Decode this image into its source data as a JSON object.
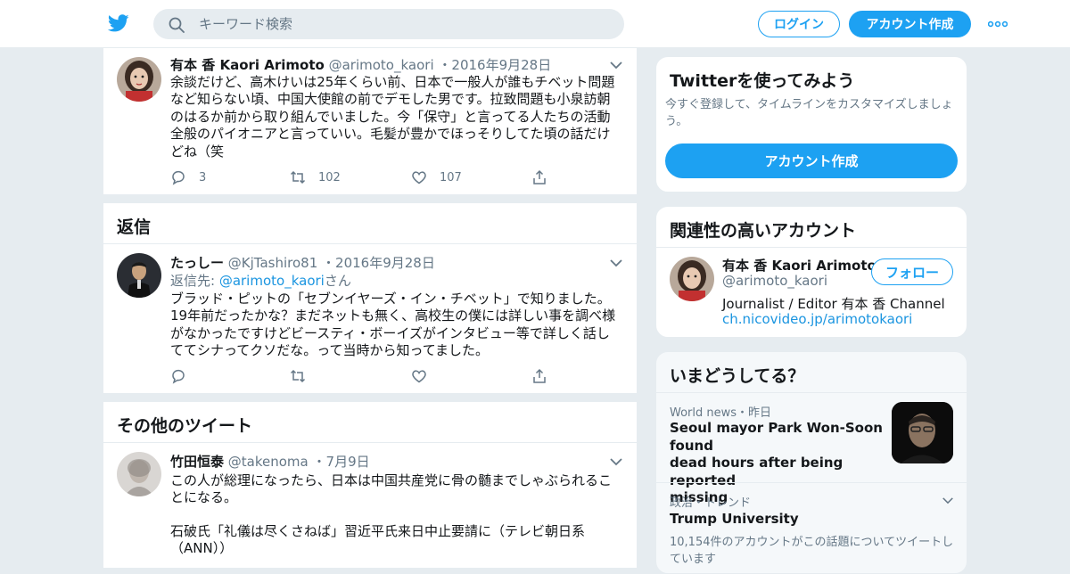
{
  "header": {
    "search_placeholder": "キーワード検索",
    "login_label": "ログイン",
    "signup_label": "アカウント作成",
    "brand_color": "#1da1f2"
  },
  "tweets": [
    {
      "name": "有本 香 Kaori Arimoto",
      "handle": "@arimoto_kaori",
      "time": "・2016年9月28日",
      "lines": [
        "余談だけど、高木けいは25年くらい前、日本で一般人が誰もチベット問題",
        "など知らない頃、中国大使館の前でデモした男です。拉致問題も小泉訪朝",
        "のはるか前から取り組んでいました。今「保守」と言ってる人たちの活動",
        "全般のパイオニアと言っていい。毛髪が豊かでほっそりしてた頃の話だけ",
        "どね（笑"
      ],
      "replies": "3",
      "retweets": "102",
      "likes": "107"
    }
  ],
  "replies_section": {
    "title": "返信",
    "tweet": {
      "name": "たっしー",
      "handle": "@KjTashiro81",
      "time": "・2016年9月28日",
      "reply_prefix": "返信先: ",
      "reply_handle": "@arimoto_kaori",
      "reply_suffix": "さん",
      "lines": [
        "ブラッド・ピットの「セブンイヤーズ・イン・チベット」で知りました。",
        "19年前だったかな？まだネットも無く、高校生の僕には詳しい事を調べ様",
        "がなかったですけどビースティ・ボーイズがインタビュー等で詳しく話し",
        "ててシナってクソだな。って当時から知ってました。"
      ]
    }
  },
  "more_section": {
    "title": "その他のツイート",
    "tweet": {
      "name": "竹田恒泰",
      "handle": "@takenoma",
      "time": "・7月9日",
      "lines": [
        "この人が総理になったら、日本は中国共産党に骨の髄までしゃぶられるこ",
        "とになる。"
      ],
      "lines2": [
        "石破氏「礼儀は尽くさねば」習近平氏来日中止要請に（テレビ朝日系",
        "（ANN））"
      ]
    }
  },
  "signup_card": {
    "title": "Twitterを使ってみよう",
    "subtitle_lines": [
      "今すぐ登録して、タイムラインをカスタマイズしましょ",
      "う。"
    ],
    "button": "アカウント作成"
  },
  "related_card": {
    "title": "関連性の高いアカウント",
    "name": "有本 香 Kaori Arimoto",
    "handle": "@arimoto_kaori",
    "bio": "Journalist / Editor 有本 香 Channel",
    "link": "ch.nicovideo.jp/arimotokaori",
    "follow_label": "フォロー"
  },
  "trends_card": {
    "title": "いまどうしてる？",
    "items": [
      {
        "meta": "World news・昨日",
        "lines": [
          "Seoul mayor Park Won-Soon found",
          "dead hours after being reported",
          "missing"
        ]
      },
      {
        "meta": "政治・トレンド",
        "title": "Trump University",
        "count_lines": [
          "10,154件のアカウントがこの話題についてツイートし",
          "ています"
        ]
      }
    ]
  }
}
